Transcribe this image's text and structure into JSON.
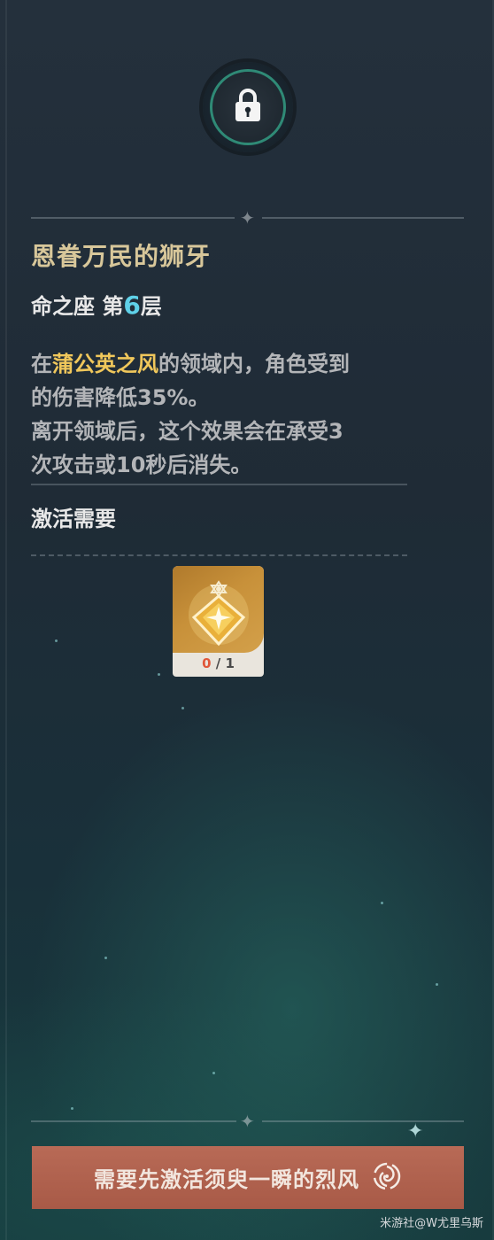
{
  "constellation": {
    "name": "恩眷万民的狮牙",
    "level_prefix": "命之座 第",
    "level_number": "6",
    "level_suffix": "层",
    "description": {
      "line1_pre": "在",
      "line1_highlight": "蒲公英之风",
      "line1_post": "的领域内，角色受到",
      "line2": "的伤害降低35%。",
      "line3": "离开领域后，这个效果会在承受3",
      "line4": "次攻击或10秒后消失。"
    }
  },
  "requirements": {
    "label": "激活需要",
    "item": {
      "icon": "stella-fortuna-icon",
      "have": "0",
      "separator": "/",
      "need": "1"
    }
  },
  "action": {
    "label": "需要先激活须臾一瞬的烈风",
    "icon": "anemo-element-icon"
  },
  "watermark": "米游社@W尤里乌斯",
  "colors": {
    "title_gold": "#d8c79a",
    "highlight_gold": "#f0c75b",
    "level_cyan": "#5fd1e8",
    "button_red": "#b86a56",
    "count_red": "#e0573a"
  }
}
